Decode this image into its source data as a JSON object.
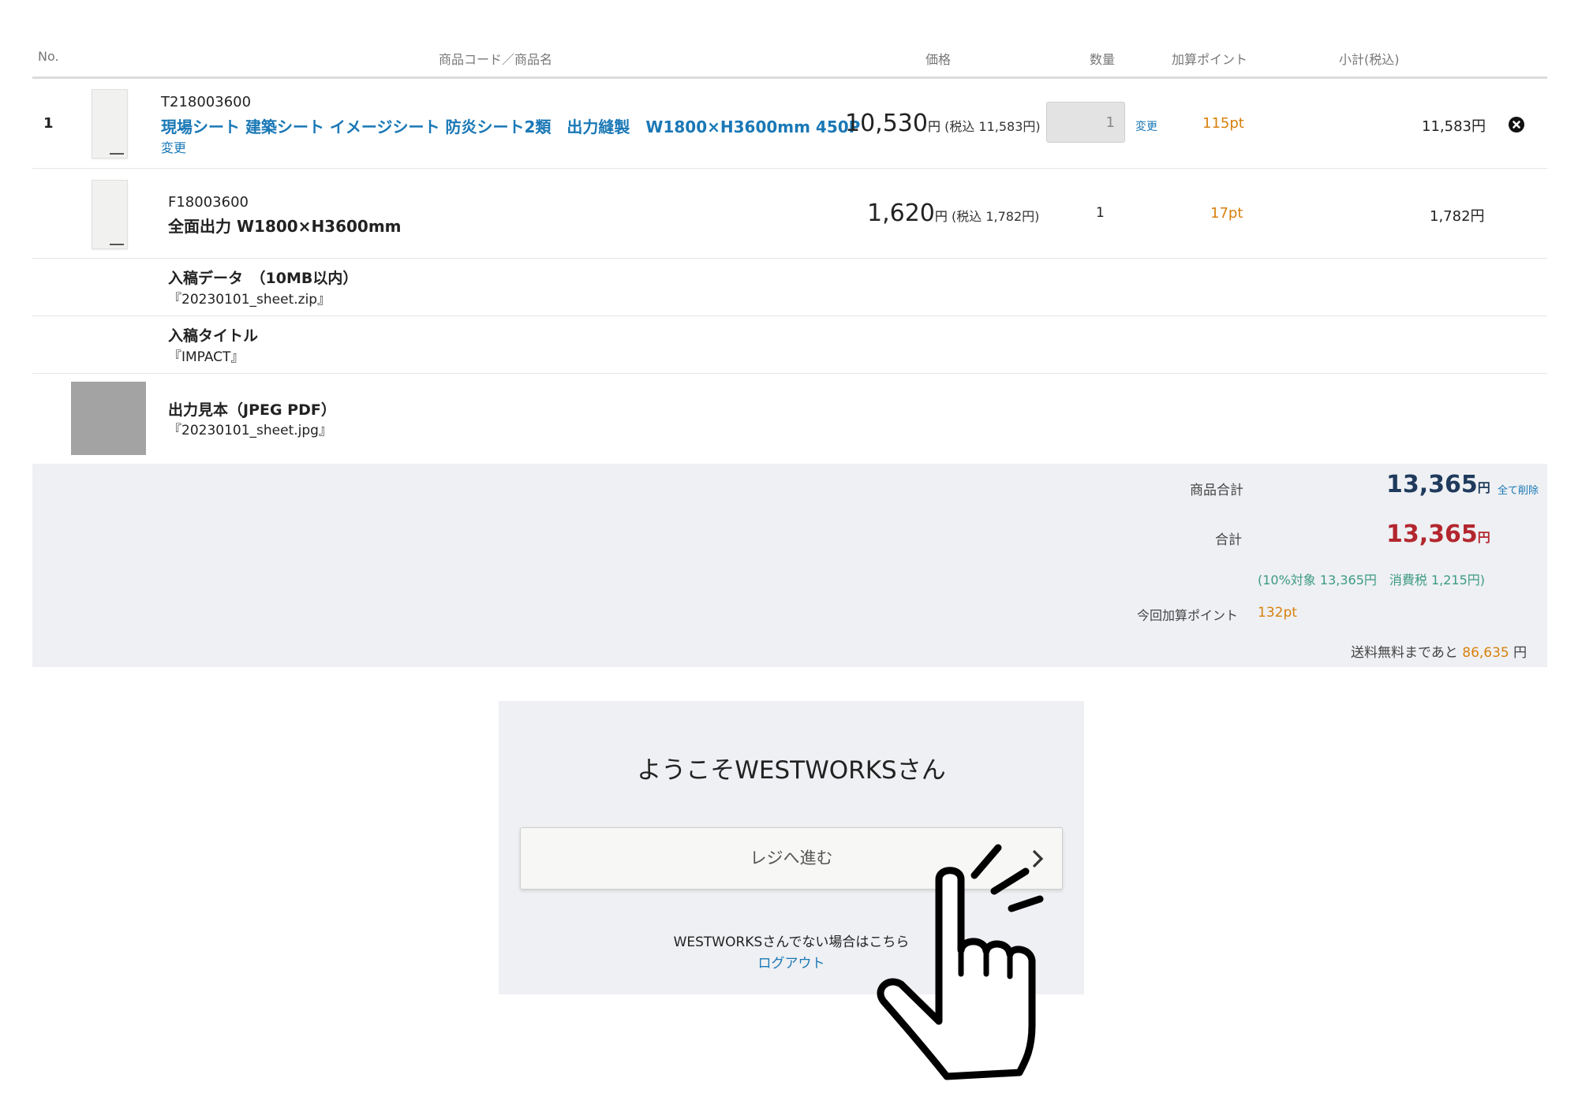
{
  "table": {
    "headers": {
      "no": "No.",
      "product": "商品コード／商品名",
      "price": "価格",
      "qty": "数量",
      "points": "加算ポイント",
      "subtotal": "小計(税込)"
    },
    "item1": {
      "no": "1",
      "code": "T218003600",
      "name": "現場シート 建築シート イメージシート 防炎シート2類　出力縫製　W1800×H3600mm 450P",
      "change_link": "変更",
      "price": "10,530",
      "yen": "円",
      "tax_price": "(税込 11,583円)",
      "qty_value": "1",
      "qty_change": "変更",
      "points": "115pt",
      "subtotal": "11,583円"
    },
    "item2": {
      "code": "F18003600",
      "name": "全面出力 W1800×H3600mm",
      "price": "1,620",
      "yen": "円",
      "tax_price": "(税込 1,782円)",
      "qty": "1",
      "points": "17pt",
      "subtotal": "1,782円"
    },
    "opt_data": {
      "label": "入稿データ　（10MB以内）",
      "value": "『20230101_sheet.zip』"
    },
    "opt_title": {
      "label": "入稿タイトル",
      "value": "『IMPACT』"
    },
    "opt_sample": {
      "label": "出力見本（JPEG PDF）",
      "value": "『20230101_sheet.jpg』"
    }
  },
  "summary": {
    "goods_total_label": "商品合計",
    "goods_total": "13,365",
    "yen": "円",
    "delete_all": "全て削除",
    "total_label": "合計",
    "total": "13,365",
    "tax_note": "(10%対象 13,365円　消費税 1,215円)",
    "points_label": "今回加算ポイント",
    "points": "132pt",
    "free_ship_prefix": "送料無料まであと",
    "free_ship_amount": "86,635",
    "free_ship_suffix": "円"
  },
  "login": {
    "welcome": "ようこそWESTWORKSさん",
    "checkout_button": "レジへ進む",
    "not_you": "WESTWORKSさんでない場合はこちら",
    "logout": "ログアウト"
  },
  "colors": {
    "link": "#1a78b6",
    "points": "#d9800e",
    "total_red": "#b3262e",
    "goods_total_navy": "#1f3a5c",
    "tax_note_green": "#3d9a83"
  },
  "icons": [
    "close-circle-icon",
    "chevron-right-icon",
    "pointing-hand-icon"
  ]
}
